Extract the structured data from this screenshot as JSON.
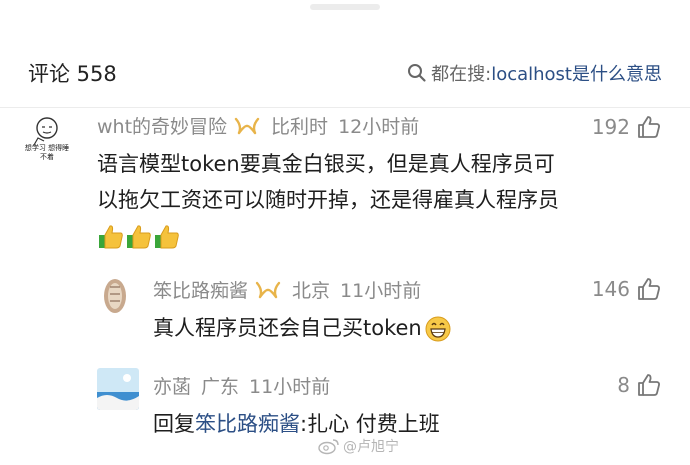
{
  "header": {
    "title": "评论 558",
    "search_prefix": "都在搜:",
    "search_link": "localhost是什么意思"
  },
  "comments": [
    {
      "name": "wht的奇妙冒险",
      "avatar_text": "想学习 想得睡不着",
      "location": "比利时",
      "time": "12小时前",
      "likes": "192",
      "lines": [
        "语言模型token要真金白银买，但是真人程序员可",
        "以拖欠工资还可以随时开掉，还是得雇真人程序员"
      ]
    },
    {
      "name": "笨比路痴酱",
      "location": "北京",
      "time": "11小时前",
      "likes": "146",
      "text": "真人程序员还会自己买token"
    },
    {
      "name": "亦菡",
      "location": "广东",
      "time": "11小时前",
      "likes": "8",
      "reply_prefix": "回复",
      "reply_to": "笨比路痴酱",
      "reply_text": ":扎心 付费上班"
    }
  ],
  "watermark": "@卢旭宁",
  "colors": {
    "link": "#2c4f85",
    "meta": "#8a8a8a",
    "vip": "#e8b44a"
  }
}
